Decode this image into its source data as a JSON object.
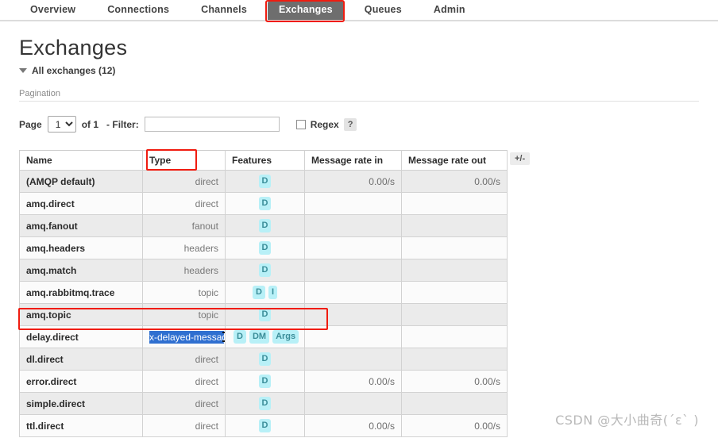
{
  "nav": {
    "tabs": [
      {
        "label": "Overview",
        "active": false
      },
      {
        "label": "Connections",
        "active": false
      },
      {
        "label": "Channels",
        "active": false
      },
      {
        "label": "Exchanges",
        "active": true
      },
      {
        "label": "Queues",
        "active": false
      },
      {
        "label": "Admin",
        "active": false
      }
    ],
    "active_tab": "Exchanges"
  },
  "page": {
    "title": "Exchanges",
    "section_toggle_label": "All exchanges (12)",
    "exchange_count": 12
  },
  "pagination": {
    "group_label": "Pagination",
    "page_label": "Page",
    "page_value": "1",
    "page_options": [
      "1"
    ],
    "of_label": "of 1",
    "filter_label": "- Filter:",
    "filter_value": "",
    "filter_placeholder": "",
    "regex_label": "Regex",
    "regex_checked": false,
    "help_label": "?"
  },
  "table": {
    "columns": [
      "Name",
      "Type",
      "Features",
      "Message rate in",
      "Message rate out"
    ],
    "plus_minus_label": "+/-",
    "rows": [
      {
        "name": "(AMQP default)",
        "type": "direct",
        "features": [
          "D"
        ],
        "rate_in": "0.00/s",
        "rate_out": "0.00/s",
        "selected": false,
        "highlighted": false
      },
      {
        "name": "amq.direct",
        "type": "direct",
        "features": [
          "D"
        ],
        "rate_in": "",
        "rate_out": "",
        "selected": false,
        "highlighted": false
      },
      {
        "name": "amq.fanout",
        "type": "fanout",
        "features": [
          "D"
        ],
        "rate_in": "",
        "rate_out": "",
        "selected": false,
        "highlighted": false
      },
      {
        "name": "amq.headers",
        "type": "headers",
        "features": [
          "D"
        ],
        "rate_in": "",
        "rate_out": "",
        "selected": false,
        "highlighted": false
      },
      {
        "name": "amq.match",
        "type": "headers",
        "features": [
          "D"
        ],
        "rate_in": "",
        "rate_out": "",
        "selected": false,
        "highlighted": false
      },
      {
        "name": "amq.rabbitmq.trace",
        "type": "topic",
        "features": [
          "D",
          "I"
        ],
        "rate_in": "",
        "rate_out": "",
        "selected": false,
        "highlighted": false
      },
      {
        "name": "amq.topic",
        "type": "topic",
        "features": [
          "D"
        ],
        "rate_in": "",
        "rate_out": "",
        "selected": false,
        "highlighted": false
      },
      {
        "name": "delay.direct",
        "type": "x-delayed-message",
        "features": [
          "D",
          "DM",
          "Args"
        ],
        "rate_in": "",
        "rate_out": "",
        "selected": true,
        "highlighted": true
      },
      {
        "name": "dl.direct",
        "type": "direct",
        "features": [
          "D"
        ],
        "rate_in": "",
        "rate_out": "",
        "selected": false,
        "highlighted": false
      },
      {
        "name": "error.direct",
        "type": "direct",
        "features": [
          "D"
        ],
        "rate_in": "0.00/s",
        "rate_out": "0.00/s",
        "selected": false,
        "highlighted": false
      },
      {
        "name": "simple.direct",
        "type": "direct",
        "features": [
          "D"
        ],
        "rate_in": "",
        "rate_out": "",
        "selected": false,
        "highlighted": false
      },
      {
        "name": "ttl.direct",
        "type": "direct",
        "features": [
          "D"
        ],
        "rate_in": "0.00/s",
        "rate_out": "0.00/s",
        "selected": false,
        "highlighted": false
      }
    ]
  },
  "annotations": {
    "color": "#f01c10",
    "targets": [
      "exchanges-tab",
      "type-column-header",
      "delay-direct-row"
    ]
  },
  "watermark": {
    "text": "CSDN @大小曲奇(´ε`  )"
  },
  "colors": {
    "active_tab_bg": "#6e6e6e",
    "annotation_red": "#f01c10",
    "badge_bg": "#b8f0f7",
    "badge_text": "#3a8d99",
    "selection_blue": "#2f6fd0"
  }
}
